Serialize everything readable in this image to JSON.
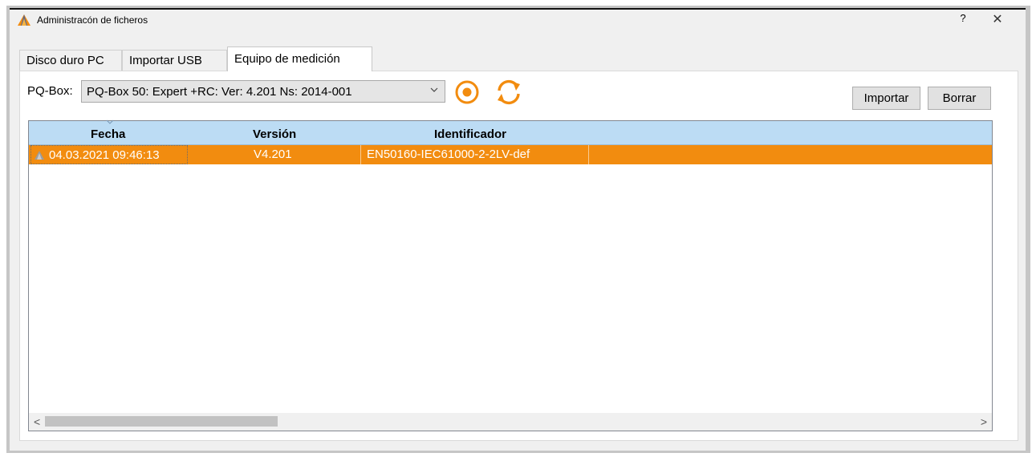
{
  "window": {
    "title": "Administracón de ficheros",
    "help_label": "?",
    "close_label": "✕"
  },
  "tabs": [
    {
      "label": "Disco duro PC",
      "active": false
    },
    {
      "label": "Importar USB",
      "active": false
    },
    {
      "label": "Equipo de medición",
      "active": true
    }
  ],
  "toolbar": {
    "pq_label": "PQ-Box:",
    "device_selected": "PQ-Box 50: Expert +RC: Ver: 4.201 Ns: 2014-001",
    "import_label": "Importar",
    "delete_label": "Borrar"
  },
  "table": {
    "columns": [
      "Fecha",
      "Versión",
      "Identificador"
    ],
    "rows": [
      {
        "date": "04.03.2021 09:46:13",
        "version": "V4.201",
        "identifier": "EN50160-IEC61000-2-2LV-def"
      }
    ]
  },
  "scrollbar": {
    "left_arrow": "<",
    "right_arrow": ">"
  },
  "colors": {
    "accent": "#f28c0f",
    "header_bg": "#bcdcf4",
    "window_bg": "#f0f0f0"
  },
  "icons": {
    "app": "app-logo-icon",
    "record": "record-icon",
    "refresh": "refresh-icon"
  }
}
